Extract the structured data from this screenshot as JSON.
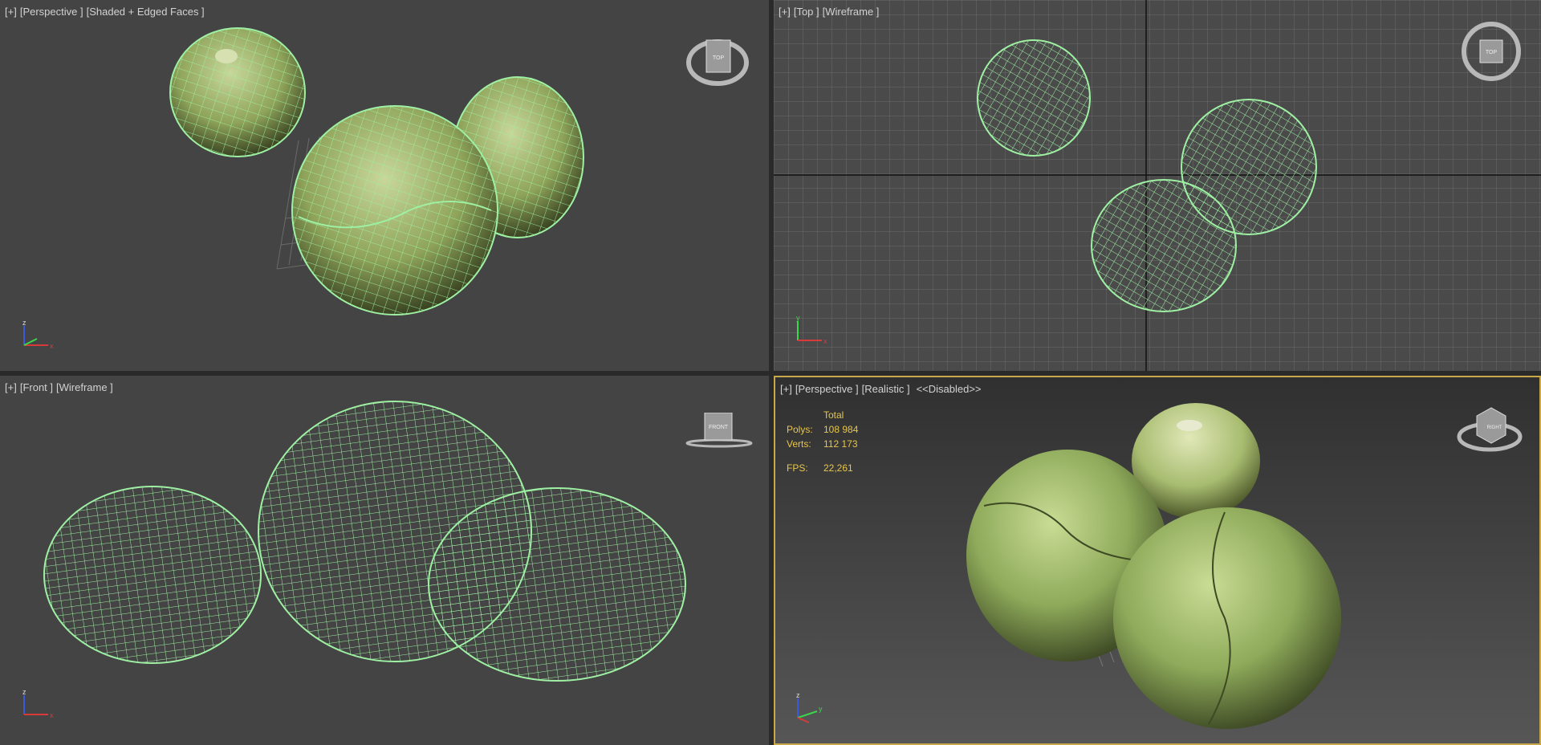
{
  "viewports": {
    "top_left": {
      "plus": "[+]",
      "view": "[Perspective ]",
      "shading": "[Shaded + Edged Faces ]"
    },
    "top_right": {
      "plus": "[+]",
      "view": "[Top ]",
      "shading": "[Wireframe ]"
    },
    "bottom_left": {
      "plus": "[+]",
      "view": "[Front ]",
      "shading": "[Wireframe ]"
    },
    "bottom_right": {
      "plus": "[+]",
      "view": "[Perspective ]",
      "shading": "[Realistic ]",
      "extra": "<<Disabled>>"
    }
  },
  "stats": {
    "header": "Total",
    "polys_label": "Polys:",
    "polys_value": "108 984",
    "verts_label": "Verts:",
    "verts_value": "112 173",
    "fps_label": "FPS:",
    "fps_value": "22,261"
  },
  "viewcube": {
    "top": "TOP",
    "front": "FRONT",
    "right": "RIGHT"
  },
  "axes": {
    "x": "x",
    "y": "y",
    "z": "z"
  },
  "colors": {
    "wire": "#9ef0a3",
    "active_border": "#c8a84a",
    "stats_text": "#e9c64a"
  }
}
